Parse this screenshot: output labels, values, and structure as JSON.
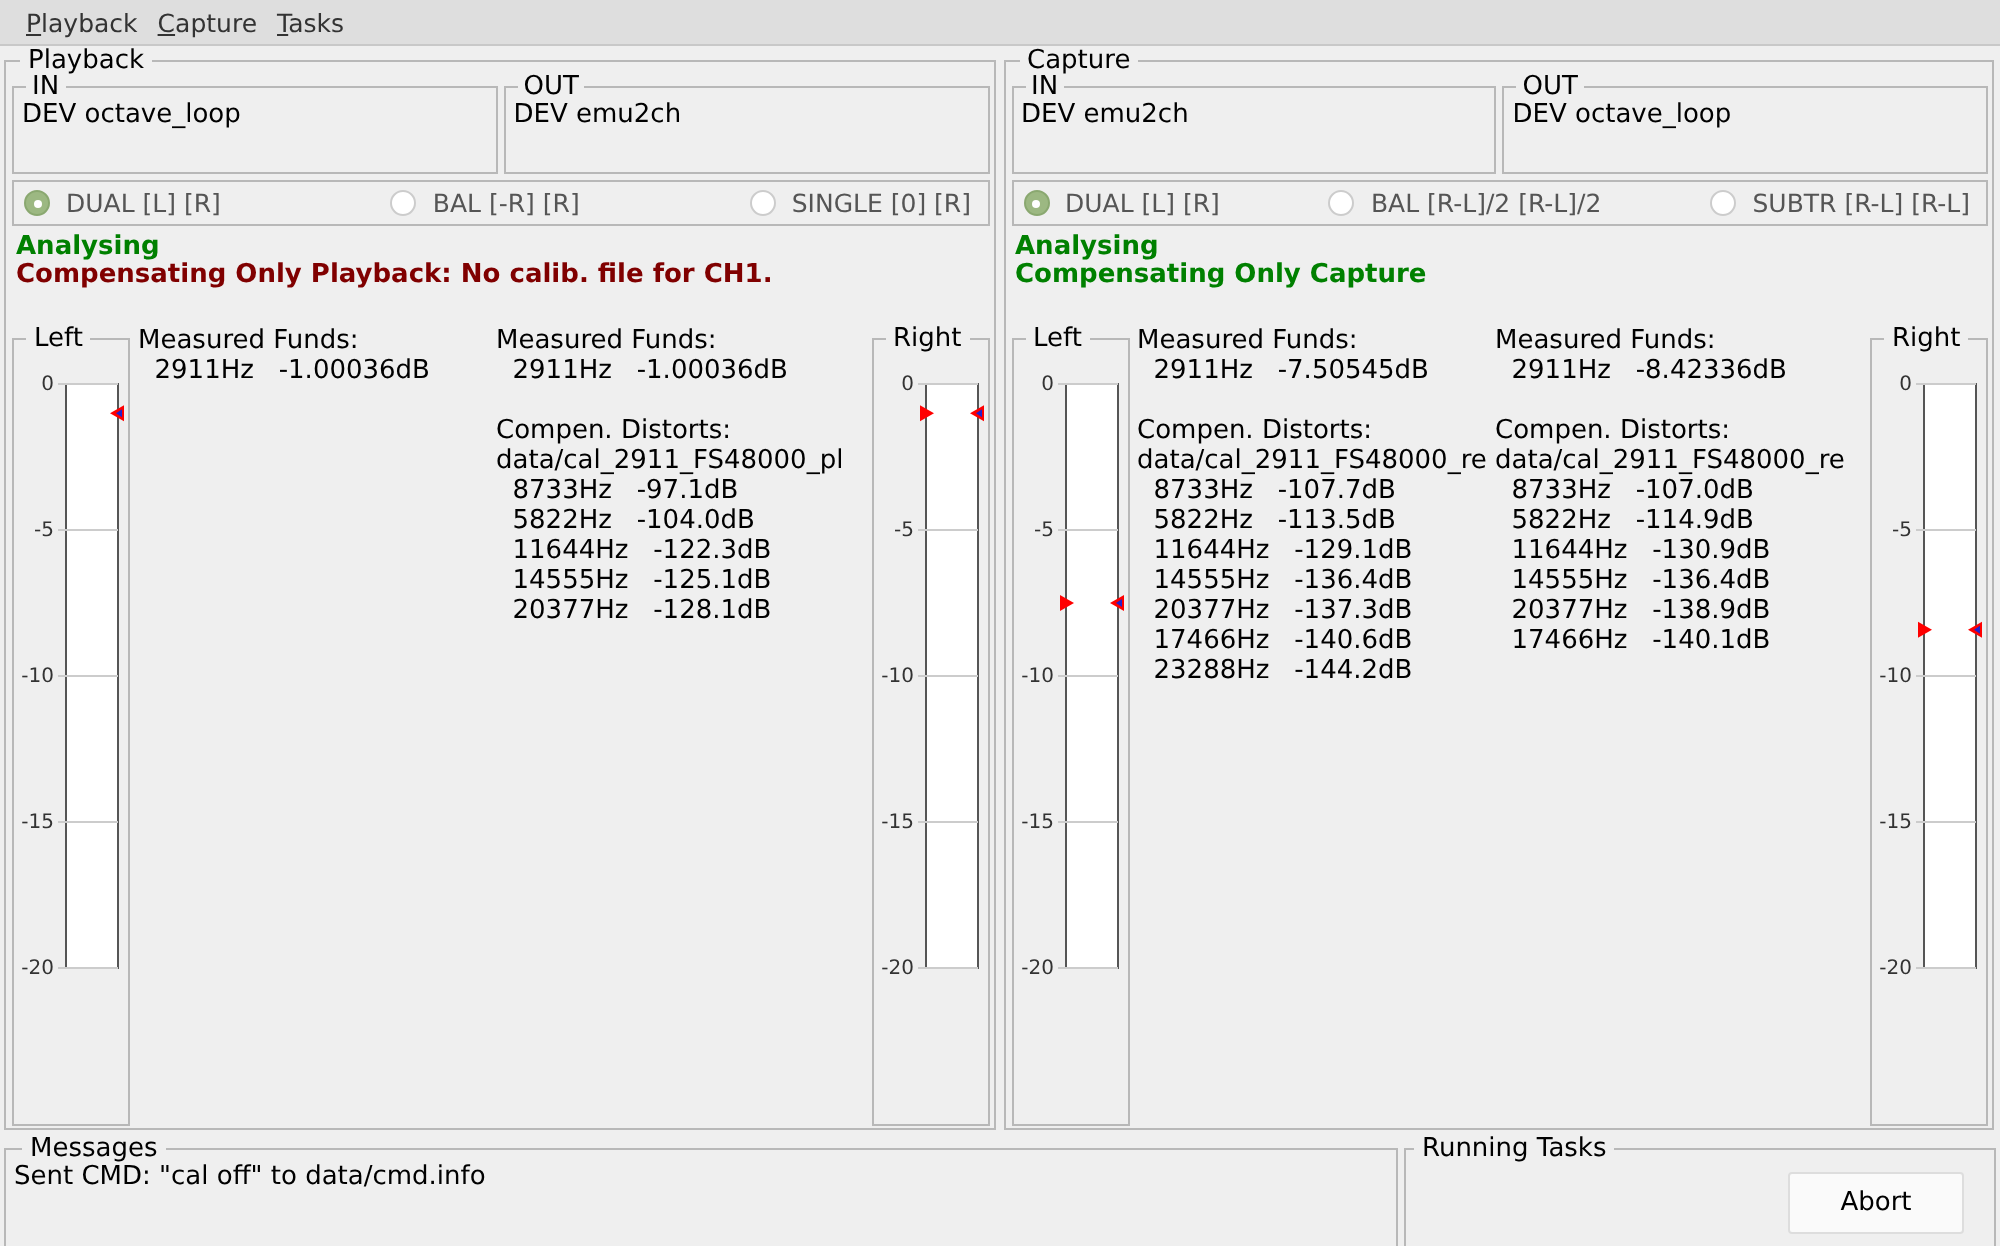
{
  "menu": [
    {
      "label": "Playback"
    },
    {
      "label": "Capture"
    },
    {
      "label": "Tasks"
    }
  ],
  "panels": [
    {
      "title": "Playback",
      "in": {
        "label": "IN",
        "device": "DEV octave_loop"
      },
      "out": {
        "label": "OUT",
        "device": "DEV emu2ch"
      },
      "modes": [
        {
          "label": "DUAL [L] [R]",
          "selected": true
        },
        {
          "label": "BAL [-R] [R]",
          "selected": false
        },
        {
          "label": "SINGLE [0] [R]",
          "selected": false
        }
      ],
      "status": [
        {
          "text": "Analysing",
          "color": "#008000"
        },
        {
          "text": "Compensating Only Playback:  No calib. file for CH1.",
          "color": "#800000"
        }
      ],
      "meters": [
        {
          "title": "Left",
          "ticks": [
            "0",
            "-5",
            "-10",
            "-15",
            "-20"
          ],
          "markers": [
            {
              "kind": "out",
              "level": 0.95
            }
          ]
        },
        {
          "title": "Right",
          "ticks": [
            "0",
            "-5",
            "-10",
            "-15",
            "-20"
          ],
          "markers": [
            {
              "kind": "in",
              "level": 0.95
            },
            {
              "kind": "out",
              "level": 0.95
            }
          ]
        }
      ],
      "readouts": [
        {
          "blocks": [
            {
              "lines": [
                "Measured Funds:",
                "  2911Hz   -1.00036dB"
              ]
            }
          ]
        },
        {
          "blocks": [
            {
              "lines": [
                "Measured Funds:",
                "  2911Hz   -1.00036dB"
              ]
            },
            {
              "lines": [
                "Compen. Distorts:",
                "data/cal_2911_FS48000_pl",
                "  8733Hz   -97.1dB",
                "  5822Hz   -104.0dB",
                "  11644Hz   -122.3dB",
                "  14555Hz   -125.1dB",
                "  20377Hz   -128.1dB"
              ]
            }
          ]
        }
      ]
    },
    {
      "title": "Capture",
      "in": {
        "label": "IN",
        "device": "DEV emu2ch"
      },
      "out": {
        "label": "OUT",
        "device": "DEV octave_loop"
      },
      "modes": [
        {
          "label": "DUAL [L] [R]",
          "selected": true
        },
        {
          "label": "BAL [R-L]/2 [R-L]/2",
          "selected": false
        },
        {
          "label": "SUBTR [R-L] [R-L]",
          "selected": false
        }
      ],
      "status": [
        {
          "text": "Analysing",
          "color": "#008000"
        },
        {
          "text": "Compensating Only Capture",
          "color": "#008000"
        }
      ],
      "meters": [
        {
          "title": "Left",
          "ticks": [
            "0",
            "-5",
            "-10",
            "-15",
            "-20"
          ],
          "markers": [
            {
              "kind": "in",
              "level": 0.625
            },
            {
              "kind": "out",
              "level": 0.625
            }
          ]
        },
        {
          "title": "Right",
          "ticks": [
            "0",
            "-5",
            "-10",
            "-15",
            "-20"
          ],
          "markers": [
            {
              "kind": "in",
              "level": 0.579
            },
            {
              "kind": "out",
              "level": 0.579
            }
          ]
        }
      ],
      "readouts": [
        {
          "blocks": [
            {
              "lines": [
                "Measured Funds:",
                "  2911Hz   -7.50545dB"
              ]
            },
            {
              "lines": [
                "Compen. Distorts:",
                "data/cal_2911_FS48000_re",
                "  8733Hz   -107.7dB",
                "  5822Hz   -113.5dB",
                "  11644Hz   -129.1dB",
                "  14555Hz   -136.4dB",
                "  20377Hz   -137.3dB",
                "  17466Hz   -140.6dB",
                "  23288Hz   -144.2dB"
              ]
            }
          ]
        },
        {
          "blocks": [
            {
              "lines": [
                "Measured Funds:",
                "  2911Hz   -8.42336dB"
              ]
            },
            {
              "lines": [
                "Compen. Distorts:",
                "data/cal_2911_FS48000_re",
                "  8733Hz   -107.0dB",
                "  5822Hz   -114.9dB",
                "  11644Hz   -130.9dB",
                "  14555Hz   -136.4dB",
                "  20377Hz   -138.9dB",
                "  17466Hz   -140.1dB"
              ]
            }
          ]
        }
      ]
    }
  ],
  "messages": {
    "title": "Messages",
    "text": "Sent CMD: \"cal off\" to data/cmd.info"
  },
  "tasks": {
    "title": "Running Tasks",
    "button": "Abort"
  }
}
